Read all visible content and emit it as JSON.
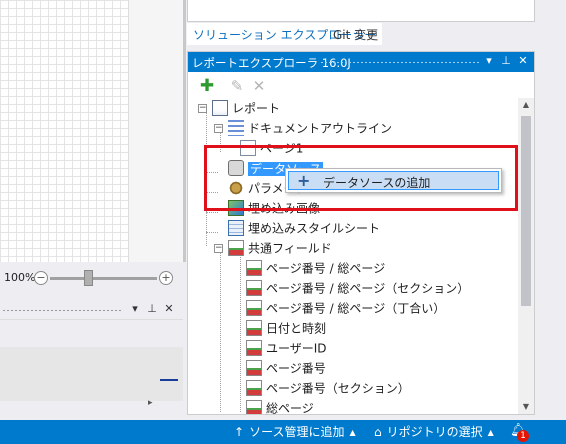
{
  "designer": {
    "zoom_label": "100%",
    "zoom_minus": "−",
    "zoom_plus": "+",
    "zoom_level": 0.5
  },
  "lower_panel": {
    "dropdown_glyph": "▾",
    "pin_glyph": "⊥",
    "close_glyph": "✕",
    "scroll_right_glyph": "▸"
  },
  "tabs": [
    {
      "label": "ソリューション エクスプローラー",
      "active": true
    },
    {
      "label": "Git 変更",
      "active": false
    }
  ],
  "report_explorer": {
    "title": "レポートエクスプローラ 16.0J",
    "dropdown_glyph": "▾",
    "pin_glyph": "⊥",
    "close_glyph": "✕",
    "toolbar": {
      "add_icon": "add-icon",
      "edit_icon": "pencil-icon",
      "delete_icon": "delete-icon"
    },
    "tree": {
      "report": "レポート",
      "document_outline": "ドキュメントアウトライン",
      "page": "ページ1",
      "datasource": "データソース",
      "parameters": "パラメーター",
      "embedded_images": "埋め込み画像",
      "embedded_stylesheets": "埋め込みスタイルシート",
      "common_fields": "共通フィールド",
      "fields": [
        "ページ番号 / 総ページ",
        "ページ番号 / 総ページ（セクション）",
        "ページ番号 / 総ページ（丁合い）",
        "日付と時刻",
        "ユーザーID",
        "ページ番号",
        "ページ番号（セクション）",
        "総ページ"
      ]
    },
    "context_menu": {
      "add_datasource": "データソースの追加"
    }
  },
  "statusbar": {
    "source_control": "ソース管理に追加",
    "repository": "リポジトリの選択",
    "notification_count": "1",
    "color": "#007acc"
  },
  "colors": {
    "accent": "#007acc",
    "highlight_box": "#e0101a",
    "selection": "#3399ff"
  }
}
